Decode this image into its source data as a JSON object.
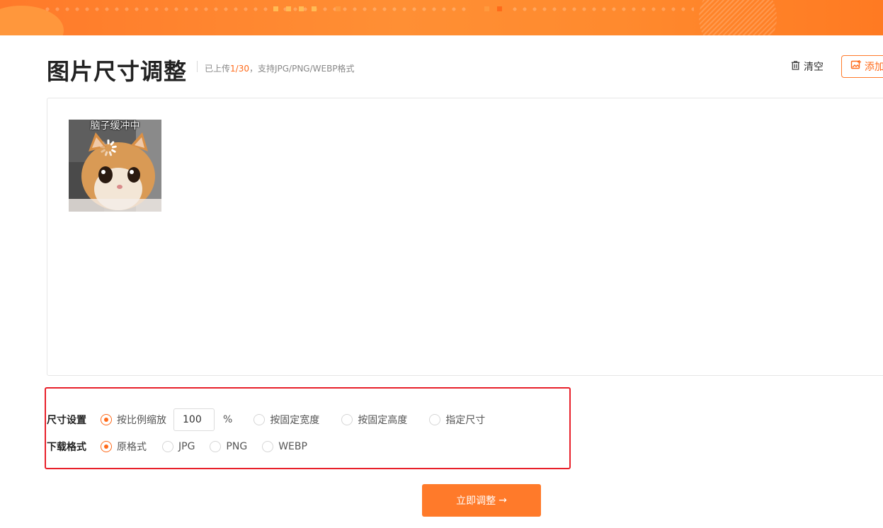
{
  "header": {
    "title": "图片尺寸调整",
    "subtitle_prefix": "已上传",
    "upload_count": "1/30",
    "subtitle_suffix": "，支持JPG/PNG/WEBP格式",
    "clear_label": "清空",
    "add_label": "添加",
    "clear_icon": "trash-icon",
    "add_icon": "add-image-icon"
  },
  "upload_area": {
    "images": [
      {
        "caption": "脑子缓冲中"
      }
    ]
  },
  "settings": {
    "size_label": "尺寸设置",
    "size_options": [
      {
        "label": "按比例缩放",
        "checked": true
      },
      {
        "label": "按固定宽度",
        "checked": false
      },
      {
        "label": "按固定高度",
        "checked": false
      },
      {
        "label": "指定尺寸",
        "checked": false
      }
    ],
    "scale_value": "100",
    "scale_unit": "%",
    "format_label": "下载格式",
    "format_options": [
      {
        "label": "原格式",
        "checked": true
      },
      {
        "label": "JPG",
        "checked": false
      },
      {
        "label": "PNG",
        "checked": false
      },
      {
        "label": "WEBP",
        "checked": false
      }
    ]
  },
  "submit": {
    "label": "立即调整",
    "arrow": "→"
  },
  "colors": {
    "accent": "#ff7a2a",
    "highlight_border": "#e8202a"
  }
}
